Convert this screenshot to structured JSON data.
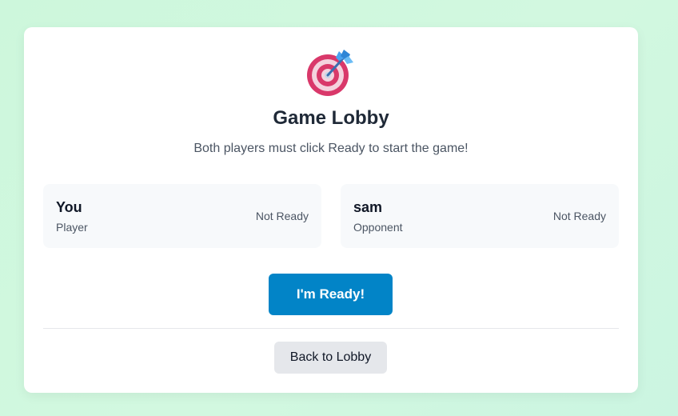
{
  "lobby": {
    "icon": "dart-target-icon",
    "title": "Game Lobby",
    "subtitle": "Both players must click Ready to start the game!"
  },
  "players": [
    {
      "name": "You",
      "role": "Player",
      "status": "Not Ready"
    },
    {
      "name": "sam",
      "role": "Opponent",
      "status": "Not Ready"
    }
  ],
  "actions": {
    "ready_label": "I'm Ready!",
    "back_label": "Back to Lobby"
  },
  "colors": {
    "background": "#cdf7dc",
    "ready_button": "#0284c7",
    "back_button": "#e5e7eb",
    "player_card": "#f7f9fb",
    "title_text": "#1f2937"
  }
}
